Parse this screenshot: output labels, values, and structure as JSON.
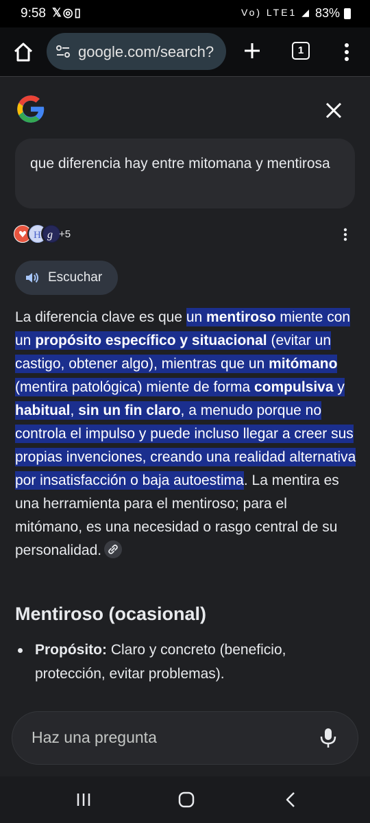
{
  "status_bar": {
    "time": "9:58",
    "left_icons": "𝕏◎▯",
    "right_icons": "Vo) LTE1 ◢",
    "battery": "83%"
  },
  "browser": {
    "url": "google.com/search?",
    "tab_count": "1"
  },
  "query": "que diferencia hay entre mitomana y mentirosa",
  "sources": {
    "extra_count": "+5"
  },
  "listen_label": "Escuchar",
  "answer": {
    "p1": "La diferencia clave es que ",
    "h1": "un ",
    "b1": "mentiroso",
    "h2": " miente con un ",
    "b2": "propósito específico y situacional",
    "h3": " (evitar un castigo, obtener algo), mientras que un ",
    "b3": "mitómano",
    "h4": " (mentira patológica) miente de forma ",
    "b4": "compulsiva",
    "h5": " y ",
    "b5": "habitual",
    "h6": ", ",
    "b6": "sin un fin claro",
    "h7": ", a menudo porque no controla el impulso y puede incluso llegar a creer sus propias invenciones, creando una realidad alternativa por insatisfacción o baja autoestima",
    "p2": ". La mentira es una herramienta para el mentiroso; para el mitómano, es una necesidad o rasgo central de su personalidad."
  },
  "section": {
    "heading": "Mentiroso (ocasional)",
    "bullet_label": "Propósito:",
    "bullet_text": " Claro y concreto (beneficio, protección, evitar problemas)."
  },
  "ask": {
    "placeholder": "Haz una pregunta"
  },
  "colors": {
    "highlight": "#1b2f8e",
    "background": "#1f2023",
    "url_pill": "#2d3b45"
  }
}
